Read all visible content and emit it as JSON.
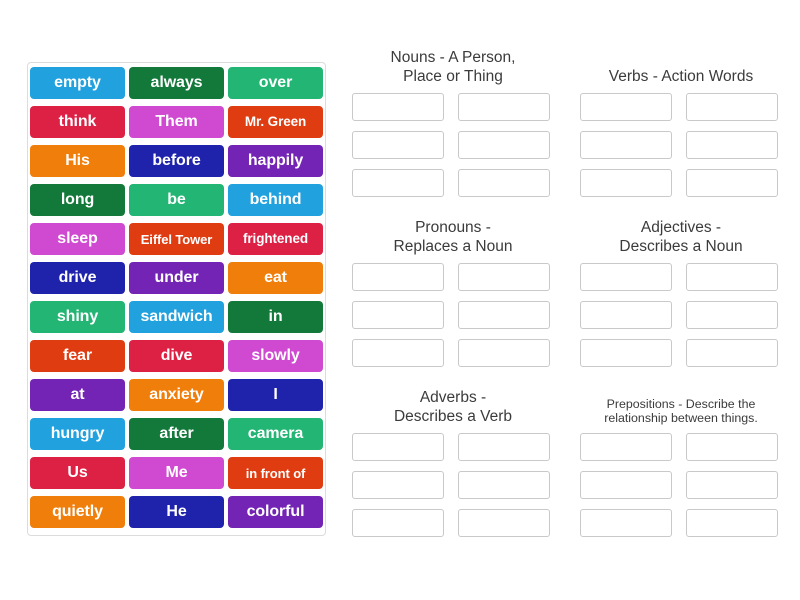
{
  "activity": {
    "type": "word-sort-drag-and-drop",
    "background_color": "#ffffff"
  },
  "word_bank": {
    "name": "word-bank",
    "columns": 3,
    "rows": 13,
    "tiles": [
      {
        "text": "empty",
        "color": "#21a1dd"
      },
      {
        "text": "always",
        "color": "#13793a"
      },
      {
        "text": "over",
        "color": "#22b573"
      },
      {
        "text": "think",
        "color": "#dc2145"
      },
      {
        "text": "Them",
        "color": "#cf4ad0"
      },
      {
        "text": "Mr. Green",
        "color": "#df3c12"
      },
      {
        "text": "His",
        "color": "#f07e0b"
      },
      {
        "text": "before",
        "color": "#1f23ac"
      },
      {
        "text": "happily",
        "color": "#7324b5"
      },
      {
        "text": "long",
        "color": "#13793a"
      },
      {
        "text": "be",
        "color": "#22b573"
      },
      {
        "text": "behind",
        "color": "#21a1dd"
      },
      {
        "text": "sleep",
        "color": "#cf4ad0"
      },
      {
        "text": "Eiffel Tower",
        "color": "#df3c12"
      },
      {
        "text": "frightened",
        "color": "#dc2145"
      },
      {
        "text": "drive",
        "color": "#1f23ac"
      },
      {
        "text": "under",
        "color": "#7324b5"
      },
      {
        "text": "eat",
        "color": "#f07e0b"
      },
      {
        "text": "shiny",
        "color": "#22b573"
      },
      {
        "text": "sandwich",
        "color": "#21a1dd"
      },
      {
        "text": "in",
        "color": "#13793a"
      },
      {
        "text": "fear",
        "color": "#df3c12"
      },
      {
        "text": "dive",
        "color": "#dc2145"
      },
      {
        "text": "slowly",
        "color": "#cf4ad0"
      },
      {
        "text": "at",
        "color": "#7324b5"
      },
      {
        "text": "anxiety",
        "color": "#f07e0b"
      },
      {
        "text": "I",
        "color": "#1f23ac"
      },
      {
        "text": "hungry",
        "color": "#21a1dd"
      },
      {
        "text": "after",
        "color": "#13793a"
      },
      {
        "text": "camera",
        "color": "#22b573"
      },
      {
        "text": "Us",
        "color": "#dc2145"
      },
      {
        "text": "Me",
        "color": "#cf4ad0"
      },
      {
        "text": "in front of",
        "color": "#df3c12"
      },
      {
        "text": "quietly",
        "color": "#f07e0b"
      },
      {
        "text": "He",
        "color": "#1f23ac"
      },
      {
        "text": "colorful",
        "color": "#7324b5"
      }
    ]
  },
  "categories": [
    {
      "name": "nouns",
      "title": "Nouns - A Person,\nPlace or Thing",
      "small_title": false,
      "slot_count": 6
    },
    {
      "name": "verbs",
      "title": "Verbs - Action Words",
      "small_title": false,
      "slot_count": 6
    },
    {
      "name": "pronouns",
      "title": "Pronouns -\nReplaces a Noun",
      "small_title": false,
      "slot_count": 6
    },
    {
      "name": "adjectives",
      "title": "Adjectives -\nDescribes a Noun",
      "small_title": false,
      "slot_count": 6
    },
    {
      "name": "adverbs",
      "title": "Adverbs -\nDescribes a Verb",
      "small_title": false,
      "slot_count": 6
    },
    {
      "name": "prepositions",
      "title": "Prepositions - Describe the\nrelationship between things.",
      "small_title": true,
      "slot_count": 6
    }
  ]
}
